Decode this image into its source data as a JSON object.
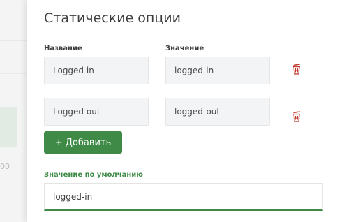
{
  "background": {
    "axis_tick": "00"
  },
  "panel": {
    "title": "Статические опции",
    "columns": {
      "name_label": "Название",
      "value_label": "Значение"
    },
    "options": [
      {
        "name": "Logged in",
        "value": "logged-in",
        "delete_icon": "trash-icon"
      },
      {
        "name": "Logged out",
        "value": "logged-out",
        "delete_icon": "trash-icon"
      }
    ],
    "add_button_label": "+ Добавить",
    "default_value": {
      "label": "Значение по умолчанию",
      "value": "logged-in"
    }
  },
  "colors": {
    "accent_green": "#3e8a46",
    "delete_red": "#c0392b",
    "field_bg": "#f3f4f5"
  }
}
